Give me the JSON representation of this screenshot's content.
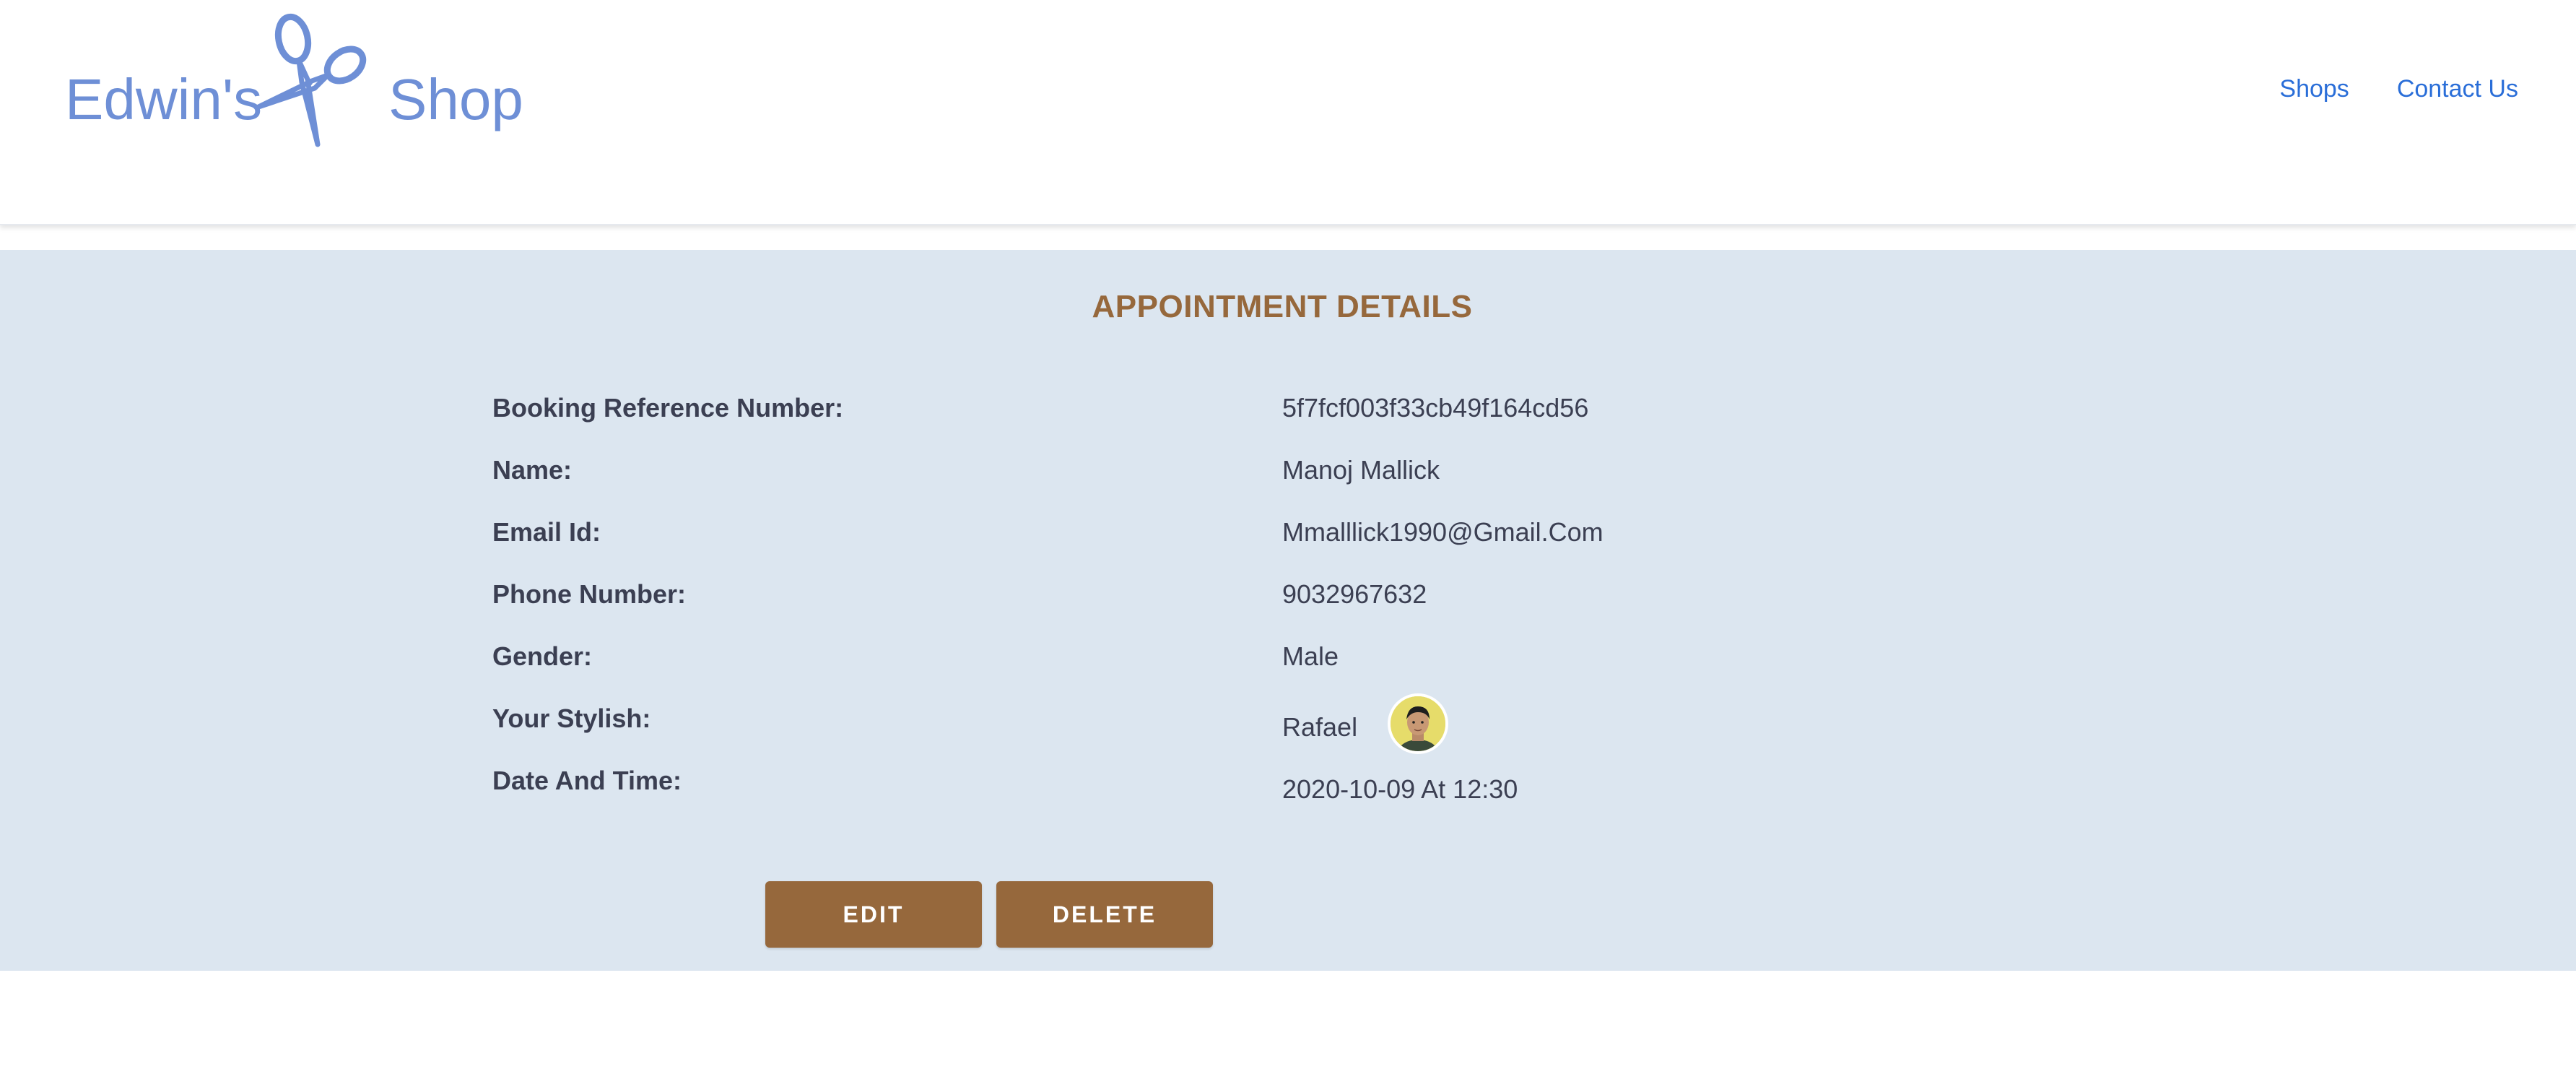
{
  "header": {
    "logo_left": "Edwin's",
    "logo_right": "Shop",
    "logo_icon": "scissors-icon",
    "nav": [
      {
        "label": "Shops"
      },
      {
        "label": "Contact Us"
      }
    ]
  },
  "appointment": {
    "title": "APPOINTMENT DETAILS",
    "fields": [
      {
        "label": "Booking Reference Number:",
        "value": "5f7fcf003f33cb49f164cd56"
      },
      {
        "label": "Name:",
        "value": "Manoj Mallick"
      },
      {
        "label": "Email Id:",
        "value": "Mmalllick1990@Gmail.Com"
      },
      {
        "label": "Phone Number:",
        "value": "9032967632"
      },
      {
        "label": "Gender:",
        "value": "Male"
      },
      {
        "label": "Your Stylish:",
        "value": "Rafael"
      },
      {
        "label": "Date And Time:",
        "value": "2020-10-09 At 12:30"
      }
    ],
    "buttons": {
      "edit": "EDIT",
      "delete": "DELETE"
    }
  },
  "colors": {
    "brand_blue": "#6e8fd6",
    "link_blue": "#2a6ed8",
    "accent_brown": "#96683c",
    "panel_bg": "#dce6f0",
    "text_dark": "#3b3f52"
  }
}
